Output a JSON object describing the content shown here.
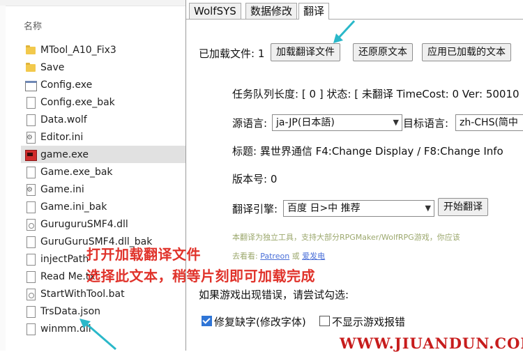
{
  "explorer": {
    "column_header": "名称",
    "files": [
      {
        "name": "MTool_A10_Fix3",
        "icon": "folder-icon"
      },
      {
        "name": "Save",
        "icon": "folder-icon"
      },
      {
        "name": "Config.exe",
        "icon": "app-window-icon"
      },
      {
        "name": "Config.exe_bak",
        "icon": "document-icon"
      },
      {
        "name": "Data.wolf",
        "icon": "document-icon"
      },
      {
        "name": "Editor.ini",
        "icon": "settings-file-icon"
      },
      {
        "name": "game.exe",
        "icon": "game-exe-icon",
        "selected": true
      },
      {
        "name": "Game.exe_bak",
        "icon": "document-icon"
      },
      {
        "name": "Game.ini",
        "icon": "settings-file-icon"
      },
      {
        "name": "Game.ini_bak",
        "icon": "document-icon"
      },
      {
        "name": "GuruguruSMF4.dll",
        "icon": "dll-file-icon"
      },
      {
        "name": "GuruGuruSMF4.dll_bak",
        "icon": "document-icon"
      },
      {
        "name": "injectPath",
        "icon": "document-icon"
      },
      {
        "name": "Read Me.txt",
        "icon": "document-icon"
      },
      {
        "name": "StartWithTool.bat",
        "icon": "dll-file-icon"
      },
      {
        "name": "TrsData.json",
        "icon": "document-icon"
      },
      {
        "name": "winmm.dll",
        "icon": "document-icon"
      }
    ]
  },
  "annotation": {
    "line1": "打开加载翻译文件",
    "line2": "选择此文本，稍等片刻即可加载完成",
    "color": "#e0322a"
  },
  "tool": {
    "tabs": [
      {
        "label": "WolfSYS",
        "active": false
      },
      {
        "label": "数据修改",
        "active": false
      },
      {
        "label": "翻译",
        "active": true
      }
    ],
    "loaded_files_label": "已加载文件: 1",
    "load_translation_button": "加载翻译文件",
    "restore_text_button": "还原原文本",
    "apply_loaded_button": "应用已加载的文本",
    "queue_status": "任务队列长度: [ 0 ] 状态: [ 未翻译 TimeCost: 0 Ver: 50010",
    "source_lang_label": "源语言:",
    "source_lang_value": "ja-JP(日本語)",
    "target_lang_label": "目标语言:",
    "target_lang_value": "zh-CHS(简中",
    "title_line": "标题: 異世界通信 F4:Change Display / F8:Change Info",
    "version_line": "版本号: 0",
    "engine_label": "翻译引擎:",
    "engine_value": "百度 日>中 推荐",
    "start_translate_button": "开始翻译",
    "note_text": "本翻译为独立工具，支持大部分RPGMaker/WolfRPG游戏，你应该",
    "note_prefix": "去看看:",
    "note_link1": "Patreon",
    "note_or": "或",
    "note_link2": "爱发电",
    "error_hint": "如果游戏出现错误，请尝试勾选:",
    "fix_missing_chars_label": "修复缺字(修改字体)",
    "fix_missing_chars_checked": true,
    "hide_game_errors_label": "不显示游戏报错",
    "hide_game_errors_checked": false
  },
  "watermark": "WWW.JIUANDUN.COM"
}
